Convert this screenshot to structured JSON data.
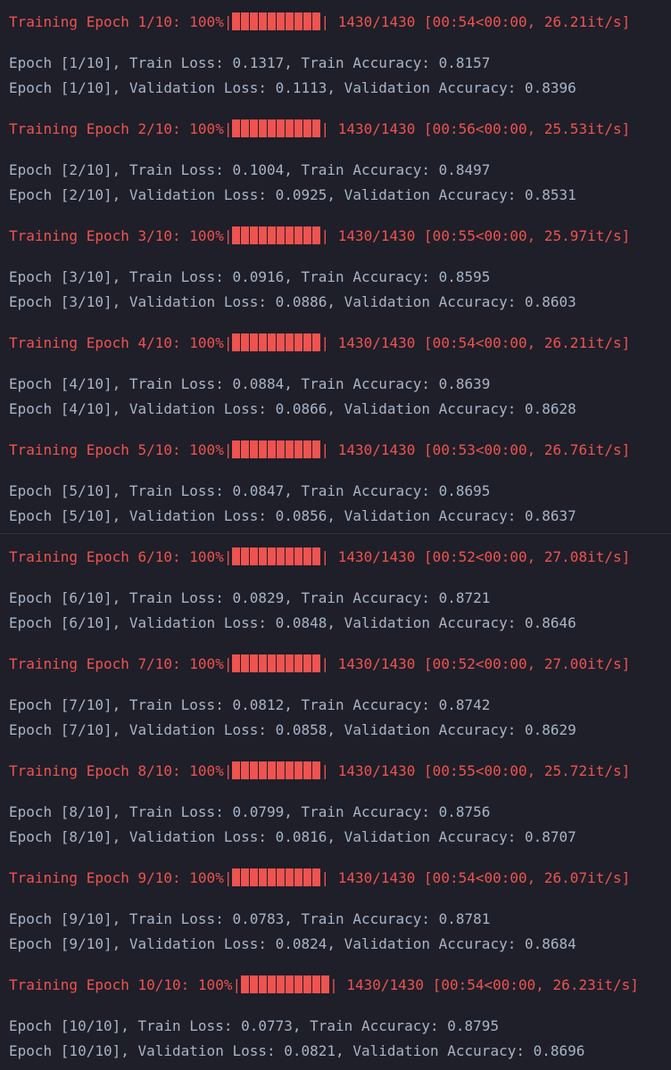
{
  "colors": {
    "background": "#1e1f29",
    "progress_text": "#f0524f",
    "log_text": "#a9b4c6"
  },
  "epochs": [
    {
      "progress_prefix": "Training Epoch 1/10: 100%|",
      "progress_fraction": 1.0,
      "progress_suffix": "| 1430/1430 [00:54<00:00, 26.21it/s]",
      "train_line": "Epoch [1/10], Train Loss: 0.1317, Train Accuracy: 0.8157",
      "val_line": "Epoch [1/10], Validation Loss: 0.1113, Validation Accuracy: 0.8396"
    },
    {
      "progress_prefix": "Training Epoch 2/10: 100%|",
      "progress_fraction": 1.0,
      "progress_suffix": "| 1430/1430 [00:56<00:00, 25.53it/s]",
      "train_line": "Epoch [2/10], Train Loss: 0.1004, Train Accuracy: 0.8497",
      "val_line": "Epoch [2/10], Validation Loss: 0.0925, Validation Accuracy: 0.8531"
    },
    {
      "progress_prefix": "Training Epoch 3/10: 100%|",
      "progress_fraction": 1.0,
      "progress_suffix": "| 1430/1430 [00:55<00:00, 25.97it/s]",
      "train_line": "Epoch [3/10], Train Loss: 0.0916, Train Accuracy: 0.8595",
      "val_line": "Epoch [3/10], Validation Loss: 0.0886, Validation Accuracy: 0.8603"
    },
    {
      "progress_prefix": "Training Epoch 4/10: 100%|",
      "progress_fraction": 1.0,
      "progress_suffix": "| 1430/1430 [00:54<00:00, 26.21it/s]",
      "train_line": "Epoch [4/10], Train Loss: 0.0884, Train Accuracy: 0.8639",
      "val_line": "Epoch [4/10], Validation Loss: 0.0866, Validation Accuracy: 0.8628"
    },
    {
      "progress_prefix": "Training Epoch 5/10: 100%|",
      "progress_fraction": 1.0,
      "progress_suffix": "| 1430/1430 [00:53<00:00, 26.76it/s]",
      "train_line": "Epoch [5/10], Train Loss: 0.0847, Train Accuracy: 0.8695",
      "val_line": "Epoch [5/10], Validation Loss: 0.0856, Validation Accuracy: 0.8637"
    },
    {
      "progress_prefix": "Training Epoch 6/10: 100%|",
      "progress_fraction": 1.0,
      "progress_suffix": "| 1430/1430 [00:52<00:00, 27.08it/s]",
      "train_line": "Epoch [6/10], Train Loss: 0.0829, Train Accuracy: 0.8721",
      "val_line": "Epoch [6/10], Validation Loss: 0.0848, Validation Accuracy: 0.8646"
    },
    {
      "progress_prefix": "Training Epoch 7/10: 100%|",
      "progress_fraction": 1.0,
      "progress_suffix": "| 1430/1430 [00:52<00:00, 27.00it/s]",
      "train_line": "Epoch [7/10], Train Loss: 0.0812, Train Accuracy: 0.8742",
      "val_line": "Epoch [7/10], Validation Loss: 0.0858, Validation Accuracy: 0.8629"
    },
    {
      "progress_prefix": "Training Epoch 8/10: 100%|",
      "progress_fraction": 1.0,
      "progress_suffix": "| 1430/1430 [00:55<00:00, 25.72it/s]",
      "train_line": "Epoch [8/10], Train Loss: 0.0799, Train Accuracy: 0.8756",
      "val_line": "Epoch [8/10], Validation Loss: 0.0816, Validation Accuracy: 0.8707"
    },
    {
      "progress_prefix": "Training Epoch 9/10: 100%|",
      "progress_fraction": 1.0,
      "progress_suffix": "| 1430/1430 [00:54<00:00, 26.07it/s]",
      "train_line": "Epoch [9/10], Train Loss: 0.0783, Train Accuracy: 0.8781",
      "val_line": "Epoch [9/10], Validation Loss: 0.0824, Validation Accuracy: 0.8684"
    },
    {
      "progress_prefix": "Training Epoch 10/10: 100%|",
      "progress_fraction": 1.0,
      "progress_suffix": "| 1430/1430 [00:54<00:00, 26.23it/s]",
      "train_line": "Epoch [10/10], Train Loss: 0.0773, Train Accuracy: 0.8795",
      "val_line": "Epoch [10/10], Validation Loss: 0.0821, Validation Accuracy: 0.8696"
    }
  ]
}
